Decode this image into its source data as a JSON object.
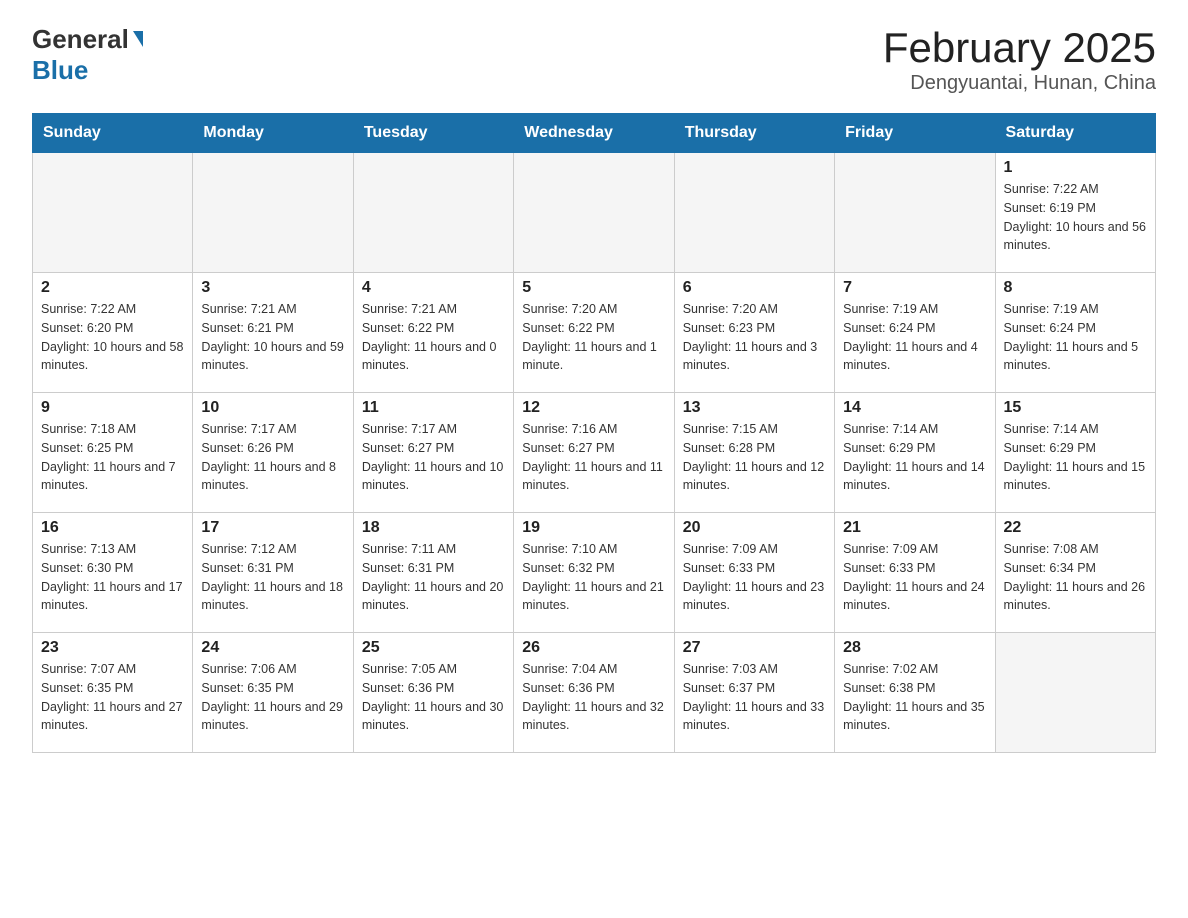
{
  "header": {
    "logo_general": "General",
    "logo_blue": "Blue",
    "title": "February 2025",
    "location": "Dengyuantai, Hunan, China"
  },
  "days_of_week": [
    "Sunday",
    "Monday",
    "Tuesday",
    "Wednesday",
    "Thursday",
    "Friday",
    "Saturday"
  ],
  "weeks": [
    {
      "days": [
        {
          "num": "",
          "info": ""
        },
        {
          "num": "",
          "info": ""
        },
        {
          "num": "",
          "info": ""
        },
        {
          "num": "",
          "info": ""
        },
        {
          "num": "",
          "info": ""
        },
        {
          "num": "",
          "info": ""
        },
        {
          "num": "1",
          "info": "Sunrise: 7:22 AM\nSunset: 6:19 PM\nDaylight: 10 hours and 56 minutes."
        }
      ]
    },
    {
      "days": [
        {
          "num": "2",
          "info": "Sunrise: 7:22 AM\nSunset: 6:20 PM\nDaylight: 10 hours and 58 minutes."
        },
        {
          "num": "3",
          "info": "Sunrise: 7:21 AM\nSunset: 6:21 PM\nDaylight: 10 hours and 59 minutes."
        },
        {
          "num": "4",
          "info": "Sunrise: 7:21 AM\nSunset: 6:22 PM\nDaylight: 11 hours and 0 minutes."
        },
        {
          "num": "5",
          "info": "Sunrise: 7:20 AM\nSunset: 6:22 PM\nDaylight: 11 hours and 1 minute."
        },
        {
          "num": "6",
          "info": "Sunrise: 7:20 AM\nSunset: 6:23 PM\nDaylight: 11 hours and 3 minutes."
        },
        {
          "num": "7",
          "info": "Sunrise: 7:19 AM\nSunset: 6:24 PM\nDaylight: 11 hours and 4 minutes."
        },
        {
          "num": "8",
          "info": "Sunrise: 7:19 AM\nSunset: 6:24 PM\nDaylight: 11 hours and 5 minutes."
        }
      ]
    },
    {
      "days": [
        {
          "num": "9",
          "info": "Sunrise: 7:18 AM\nSunset: 6:25 PM\nDaylight: 11 hours and 7 minutes."
        },
        {
          "num": "10",
          "info": "Sunrise: 7:17 AM\nSunset: 6:26 PM\nDaylight: 11 hours and 8 minutes."
        },
        {
          "num": "11",
          "info": "Sunrise: 7:17 AM\nSunset: 6:27 PM\nDaylight: 11 hours and 10 minutes."
        },
        {
          "num": "12",
          "info": "Sunrise: 7:16 AM\nSunset: 6:27 PM\nDaylight: 11 hours and 11 minutes."
        },
        {
          "num": "13",
          "info": "Sunrise: 7:15 AM\nSunset: 6:28 PM\nDaylight: 11 hours and 12 minutes."
        },
        {
          "num": "14",
          "info": "Sunrise: 7:14 AM\nSunset: 6:29 PM\nDaylight: 11 hours and 14 minutes."
        },
        {
          "num": "15",
          "info": "Sunrise: 7:14 AM\nSunset: 6:29 PM\nDaylight: 11 hours and 15 minutes."
        }
      ]
    },
    {
      "days": [
        {
          "num": "16",
          "info": "Sunrise: 7:13 AM\nSunset: 6:30 PM\nDaylight: 11 hours and 17 minutes."
        },
        {
          "num": "17",
          "info": "Sunrise: 7:12 AM\nSunset: 6:31 PM\nDaylight: 11 hours and 18 minutes."
        },
        {
          "num": "18",
          "info": "Sunrise: 7:11 AM\nSunset: 6:31 PM\nDaylight: 11 hours and 20 minutes."
        },
        {
          "num": "19",
          "info": "Sunrise: 7:10 AM\nSunset: 6:32 PM\nDaylight: 11 hours and 21 minutes."
        },
        {
          "num": "20",
          "info": "Sunrise: 7:09 AM\nSunset: 6:33 PM\nDaylight: 11 hours and 23 minutes."
        },
        {
          "num": "21",
          "info": "Sunrise: 7:09 AM\nSunset: 6:33 PM\nDaylight: 11 hours and 24 minutes."
        },
        {
          "num": "22",
          "info": "Sunrise: 7:08 AM\nSunset: 6:34 PM\nDaylight: 11 hours and 26 minutes."
        }
      ]
    },
    {
      "days": [
        {
          "num": "23",
          "info": "Sunrise: 7:07 AM\nSunset: 6:35 PM\nDaylight: 11 hours and 27 minutes."
        },
        {
          "num": "24",
          "info": "Sunrise: 7:06 AM\nSunset: 6:35 PM\nDaylight: 11 hours and 29 minutes."
        },
        {
          "num": "25",
          "info": "Sunrise: 7:05 AM\nSunset: 6:36 PM\nDaylight: 11 hours and 30 minutes."
        },
        {
          "num": "26",
          "info": "Sunrise: 7:04 AM\nSunset: 6:36 PM\nDaylight: 11 hours and 32 minutes."
        },
        {
          "num": "27",
          "info": "Sunrise: 7:03 AM\nSunset: 6:37 PM\nDaylight: 11 hours and 33 minutes."
        },
        {
          "num": "28",
          "info": "Sunrise: 7:02 AM\nSunset: 6:38 PM\nDaylight: 11 hours and 35 minutes."
        },
        {
          "num": "",
          "info": ""
        }
      ]
    }
  ]
}
